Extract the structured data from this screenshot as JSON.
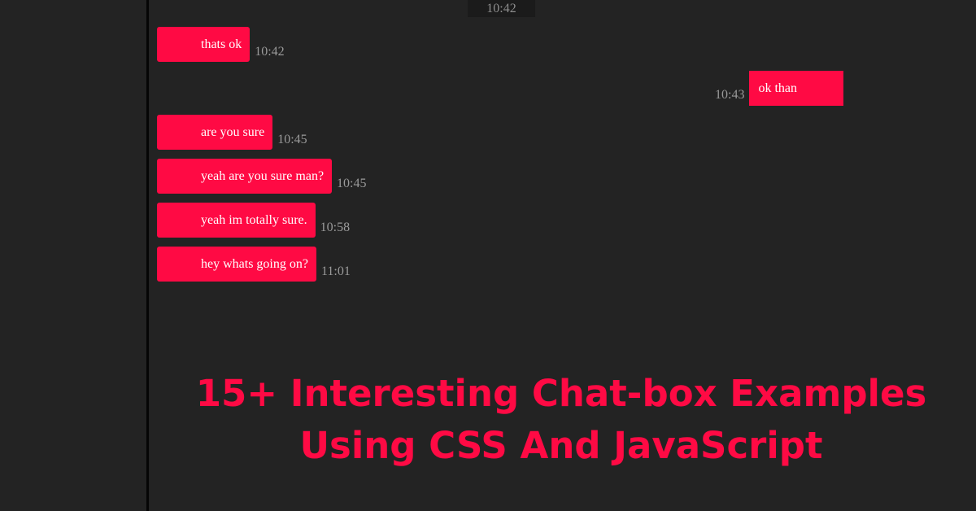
{
  "chat": {
    "top_timestamp": "10:42",
    "messages": [
      {
        "direction": "incoming",
        "text": "thats ok",
        "time": "10:42"
      },
      {
        "direction": "outgoing",
        "text": "ok than",
        "time": "10:43"
      },
      {
        "direction": "incoming",
        "text": "are you sure",
        "time": "10:45"
      },
      {
        "direction": "incoming",
        "text": "yeah are you sure man?",
        "time": "10:45"
      },
      {
        "direction": "incoming",
        "text": "yeah im totally sure.",
        "time": "10:58"
      },
      {
        "direction": "incoming",
        "text": "hey whats going on?",
        "time": "11:01"
      }
    ]
  },
  "banner": {
    "line1": "15+ Interesting Chat-box Examples",
    "line2": "Using CSS And JavaScript"
  },
  "colors": {
    "background": "#232323",
    "bubble": "#ff0a44",
    "headline": "#ff0a44",
    "timestamp": "#9a9a9a"
  }
}
